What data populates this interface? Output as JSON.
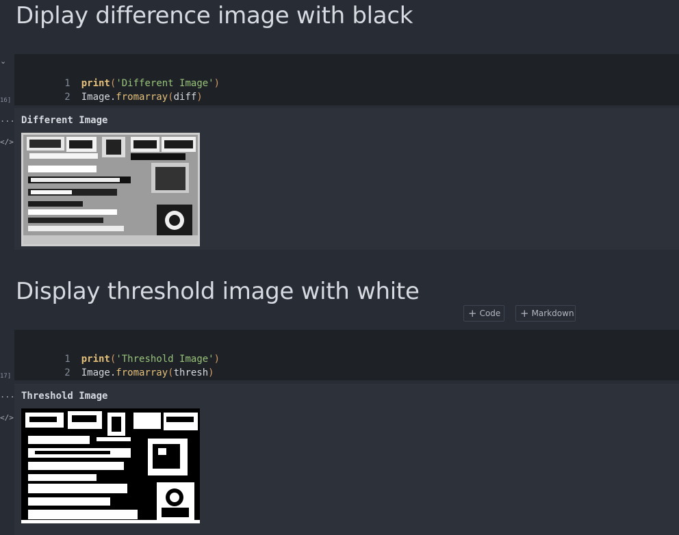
{
  "cells": [
    {
      "heading": "Diplay difference image with black",
      "exec_count": "16]",
      "code": {
        "line1_num": "1",
        "line1_fn": "print",
        "line1_open": "(",
        "line1_str": "'Different Image'",
        "line1_close": ")",
        "line2_num": "2",
        "line2_obj": "Image.",
        "line2_fn": "fromarray",
        "line2_open": "(",
        "line2_arg": "diff",
        "line2_close": ")"
      },
      "output_text": "Different Image",
      "output_image_desc": "grayscale difference image"
    },
    {
      "heading": "Display threshold image with white",
      "exec_count": "17]",
      "code": {
        "line1_num": "1",
        "line1_fn": "print",
        "line1_open": "(",
        "line1_str": "'Threshold Image'",
        "line1_close": ")",
        "line2_num": "2",
        "line2_obj": "Image.",
        "line2_fn": "fromarray",
        "line2_open": "(",
        "line2_arg": "thresh",
        "line2_close": ")"
      },
      "output_text": "Threshold Image",
      "output_image_desc": "black and white threshold image"
    }
  ],
  "toolbar": {
    "add_code_label": "Code",
    "add_markdown_label": "Markdown"
  },
  "gutter": {
    "output_dots": "...",
    "code_icon": "</>"
  },
  "colors": {
    "background": "#282c34",
    "code_bg": "#1e2227",
    "output_bg": "#2c313a",
    "function": "#e5c07b",
    "string": "#98c379",
    "paren": "#d19a66"
  }
}
